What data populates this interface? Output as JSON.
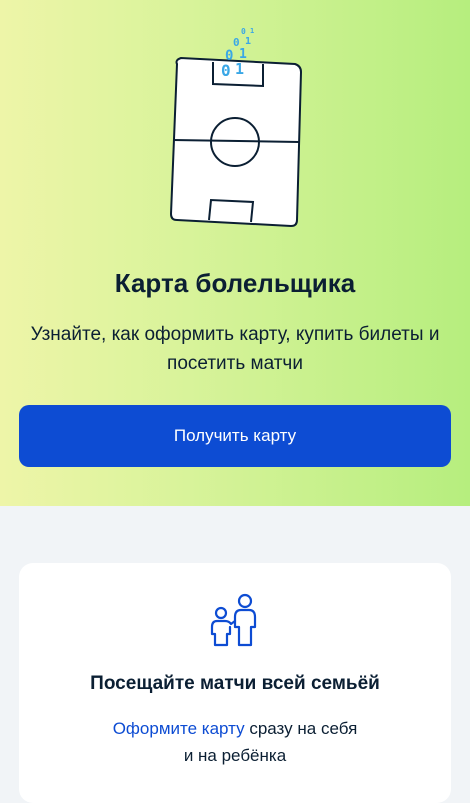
{
  "hero": {
    "title": "Карта болельщика",
    "subtitle": "Узнайте, как оформить карту, купить билеты и посетить матчи",
    "cta_label": "Получить карту",
    "binary_digits": [
      "0",
      "1",
      "0",
      "1",
      "0",
      "1",
      "0",
      "1"
    ]
  },
  "card": {
    "title": "Посещайте матчи всей семьёй",
    "link_text": "Оформите карту",
    "text_after_link": " сразу на себя",
    "text_line2": "и на ребёнка"
  },
  "colors": {
    "accent": "#0d4cd3",
    "text": "#0b1f33",
    "hero_gradient_start": "#eef5a8",
    "hero_gradient_end": "#b6ee7e",
    "card_background": "#ffffff",
    "page_background": "#f1f4f7",
    "binary_color": "#3aa7e6"
  },
  "icons": {
    "hero": "football-field-card-icon",
    "card": "family-icon"
  }
}
